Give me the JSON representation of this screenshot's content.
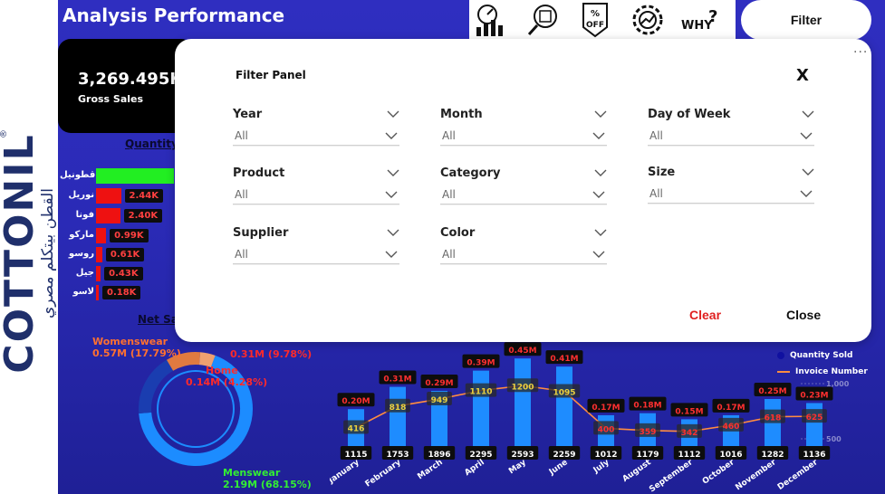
{
  "brand": {
    "name": "COTTONIL",
    "tagline": "القطن بيتكلم مصري",
    "reg": "®"
  },
  "header": {
    "title": "Analysis Performance",
    "filter_label": "Filter",
    "why_label": "WHY?",
    "off_label": "% OFF"
  },
  "kpi": {
    "value": "3,269.495K",
    "label": "Gross Sales"
  },
  "quantity_chart": {
    "title": "Quantity",
    "rows": [
      {
        "name": "قطونيل",
        "value": "",
        "fraction": 1.0,
        "color": "#22ee22"
      },
      {
        "name": "نوريل",
        "value": "2.44K",
        "fraction": 0.32,
        "color": "#ee1111"
      },
      {
        "name": "فونا",
        "value": "2.40K",
        "fraction": 0.31,
        "color": "#ee1111"
      },
      {
        "name": "ماركو",
        "value": "0.99K",
        "fraction": 0.13,
        "color": "#ee1111"
      },
      {
        "name": "روسو",
        "value": "0.61K",
        "fraction": 0.08,
        "color": "#ee1111"
      },
      {
        "name": "جيل",
        "value": "0.43K",
        "fraction": 0.06,
        "color": "#ee1111"
      },
      {
        "name": "لاسو",
        "value": "0.18K",
        "fraction": 0.02,
        "color": "#ee1111"
      }
    ]
  },
  "net_sales": {
    "title": "Net Sal",
    "segments": [
      {
        "name": "Womenswear",
        "value": "0.57M (17.79%)",
        "fraction": 0.1779,
        "color": "#1a3db0",
        "label_color": "#ff7030"
      },
      {
        "name": "",
        "value": "0.31M (9.78%)",
        "fraction": 0.0978,
        "color": "#e07a40",
        "label_color": "#ff2a2a"
      },
      {
        "name": "Home",
        "value": "0.14M (4.28%)",
        "fraction": 0.0428,
        "color": "#f0a070",
        "label_color": "#ff2a2a"
      },
      {
        "name": "Menswear",
        "value": "2.19M (68.15%)",
        "fraction": 0.6815,
        "color": "#1c8cff",
        "label_color": "#33ee33"
      }
    ]
  },
  "chart_data": {
    "type": "bar",
    "categories": [
      "January",
      "February",
      "March",
      "April",
      "May",
      "June",
      "July",
      "August",
      "September",
      "October",
      "November",
      "December"
    ],
    "series": [
      {
        "name": "",
        "values": [
          0.2,
          0.31,
          0.29,
          0.39,
          0.45,
          0.41,
          0.17,
          0.18,
          0.15,
          0.17,
          0.25,
          0.23
        ],
        "labels": [
          "0.20M",
          "0.31M",
          "0.29M",
          "0.39M",
          "0.45M",
          "0.41M",
          "0.17M",
          "0.18M",
          "0.15M",
          "0.17M",
          "0.25M",
          "0.23M"
        ]
      },
      {
        "name": "Quantity Sold",
        "values": [
          1115,
          1753,
          1896,
          2295,
          2593,
          2259,
          1012,
          1179,
          1112,
          1016,
          1282,
          1136
        ]
      },
      {
        "name": "Invoice Number",
        "values": [
          416,
          818,
          949,
          1110,
          1200,
          1095,
          400,
          359,
          342,
          460,
          618,
          625
        ]
      }
    ],
    "right_axis_ticks": [
      "1,000",
      "500"
    ],
    "ylim": [
      0,
      0.5
    ]
  },
  "legend": [
    {
      "name": "Quantity Sold",
      "kind": "dot"
    },
    {
      "name": "Invoice Number",
      "kind": "line"
    }
  ],
  "filter_panel": {
    "title": "Filter Panel",
    "close_x": "X",
    "slicers": [
      {
        "label": "Year",
        "value": "All"
      },
      {
        "label": "Month",
        "value": "All"
      },
      {
        "label": "Day of Week",
        "value": "All"
      },
      {
        "label": "Product",
        "value": "All"
      },
      {
        "label": "Category",
        "value": "All"
      },
      {
        "label": "Size",
        "value": "All"
      },
      {
        "label": "Supplier",
        "value": "All"
      },
      {
        "label": "Color",
        "value": "All"
      }
    ],
    "clear_label": "Clear",
    "close_label": "Close",
    "more_label": "···"
  },
  "colors": {
    "accent": "#2f2ec0",
    "brand": "#1f2f6b",
    "clear": "#e02020"
  }
}
